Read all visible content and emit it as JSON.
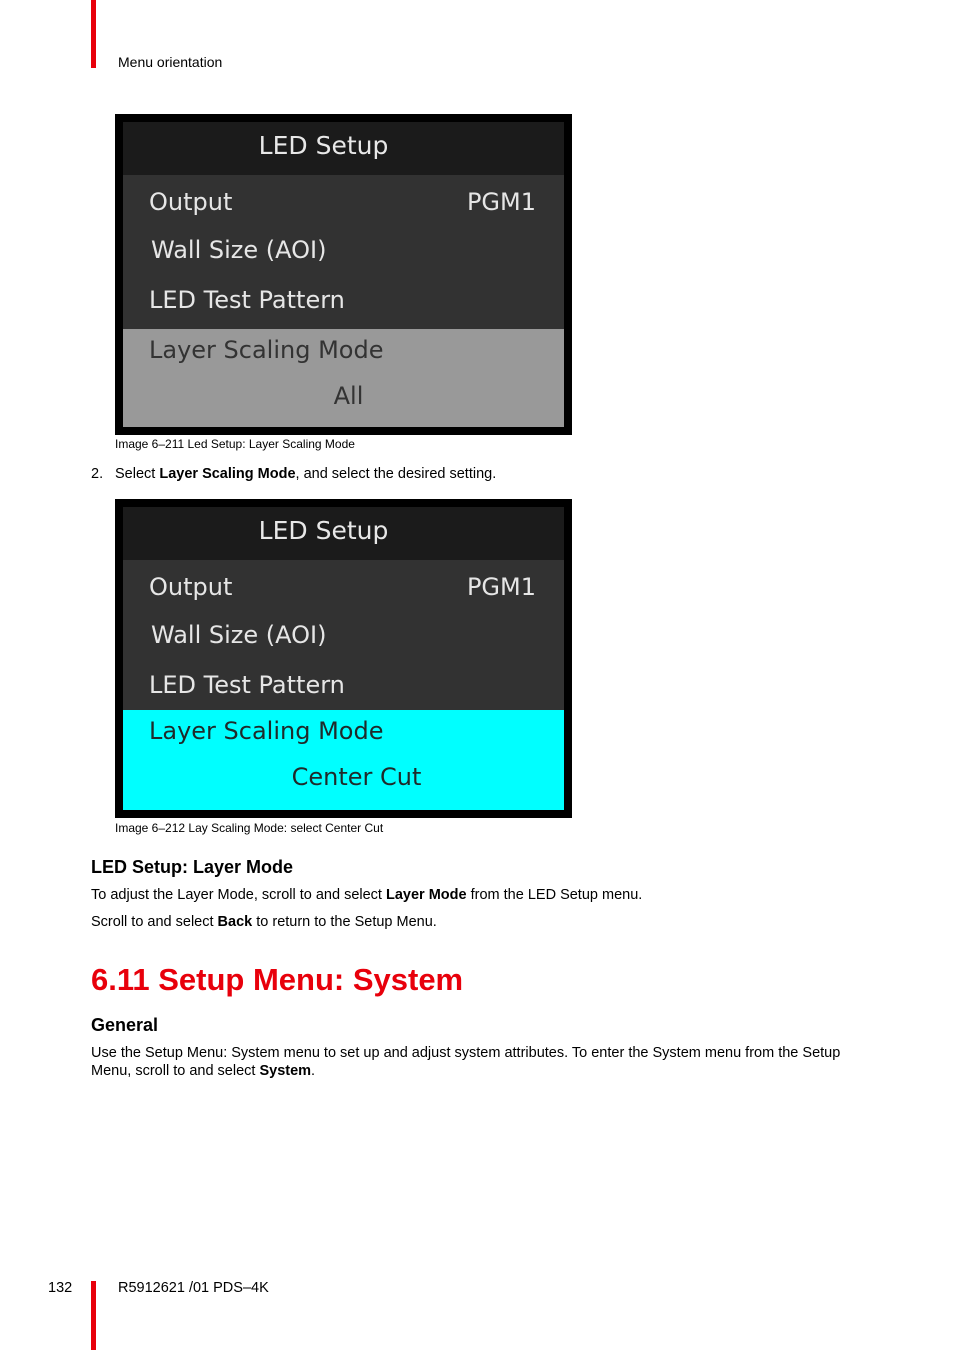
{
  "header": {
    "section": "Menu orientation"
  },
  "brand_color": "#e8000b",
  "figures": [
    {
      "screen": {
        "title": "LED Setup",
        "items": [
          {
            "label": "Output",
            "value": "PGM1"
          },
          {
            "label": "Wall Size (AOI)",
            "value": ""
          },
          {
            "label": "LED Test Pattern",
            "value": ""
          }
        ],
        "selected": {
          "label": "Layer Scaling Mode",
          "value": "All",
          "highlight_color": "#999999"
        }
      },
      "caption": "Image 6–211  Led Setup: Layer Scaling Mode"
    },
    {
      "screen": {
        "title": "LED Setup",
        "items": [
          {
            "label": "Output",
            "value": "PGM1"
          },
          {
            "label": "Wall Size (AOI)",
            "value": ""
          },
          {
            "label": "LED Test Pattern",
            "value": ""
          }
        ],
        "selected": {
          "label": "Layer Scaling Mode",
          "value": "Center Cut",
          "highlight_color": "#00ffff"
        }
      },
      "caption": "Image 6–212  Lay Scaling Mode: select Center Cut"
    }
  ],
  "step2": {
    "number": "2.",
    "text_before": "Select ",
    "bold": "Layer Scaling Mode",
    "text_after": ", and select the desired setting."
  },
  "layer_mode": {
    "heading": "LED Setup: Layer Mode",
    "p1": {
      "before": "To adjust the Layer Mode, scroll to and select ",
      "bold": "Layer Mode",
      "after": " from the LED Setup menu."
    },
    "p2": {
      "before": "Scroll to and select ",
      "bold": "Back",
      "after": " to return to the Setup Menu."
    }
  },
  "system_section": {
    "title": "6.11 Setup Menu: System",
    "subheading": "General",
    "p1": {
      "before": "Use the Setup Menu: System menu to set up and adjust system attributes. To enter the System menu from the Setup Menu, scroll to and select ",
      "bold": "System",
      "after": "."
    }
  },
  "footer": {
    "page_number": "132",
    "doc_id": "R5912621 /01  PDS–4K"
  }
}
